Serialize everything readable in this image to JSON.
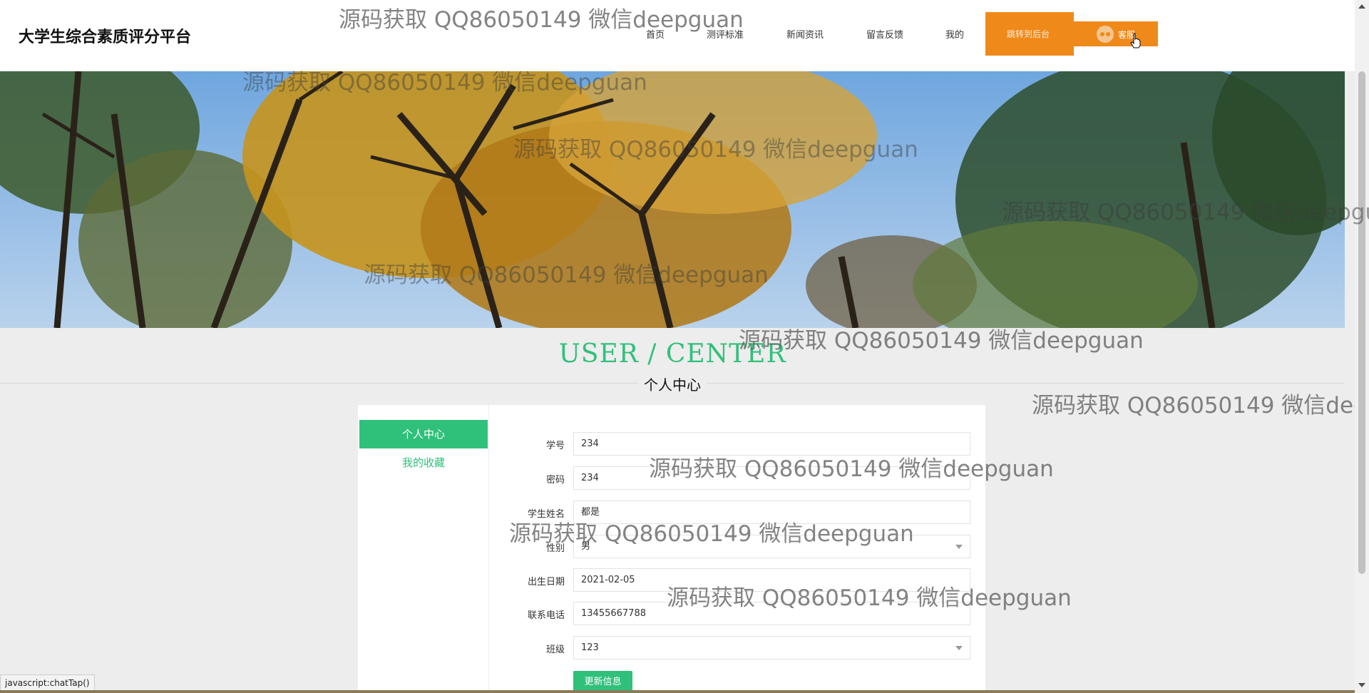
{
  "header": {
    "site_title": "大学生综合素质评分平台",
    "nav": [
      "首页",
      "测评标准",
      "新闻资讯",
      "留言反馈",
      "我的"
    ],
    "admin_button": "跳转到后台",
    "chat_button": "客服"
  },
  "section": {
    "title_en": "USER / CENTER",
    "title_cn": "个人中心"
  },
  "sidebar": {
    "items": [
      {
        "label": "个人中心",
        "active": true
      },
      {
        "label": "我的收藏",
        "active": false
      }
    ]
  },
  "form": {
    "fields": [
      {
        "label": "学号",
        "value": "234",
        "type": "text"
      },
      {
        "label": "密码",
        "value": "234",
        "type": "text"
      },
      {
        "label": "学生姓名",
        "value": "都是",
        "type": "text"
      },
      {
        "label": "性别",
        "value": "男",
        "type": "select"
      },
      {
        "label": "出生日期",
        "value": "2021-02-05",
        "type": "text"
      },
      {
        "label": "联系电话",
        "value": "13455667788",
        "type": "text"
      },
      {
        "label": "班级",
        "value": "123",
        "type": "select"
      }
    ],
    "submit_label": "更新信息"
  },
  "status_bar": "javascript:chatTap()",
  "watermark_text": "源码获取 QQ86050149 微信deepguan",
  "colors": {
    "accent_green": "#2fc07a",
    "button_orange": "#ef8a1a",
    "page_bg": "#ededed"
  }
}
